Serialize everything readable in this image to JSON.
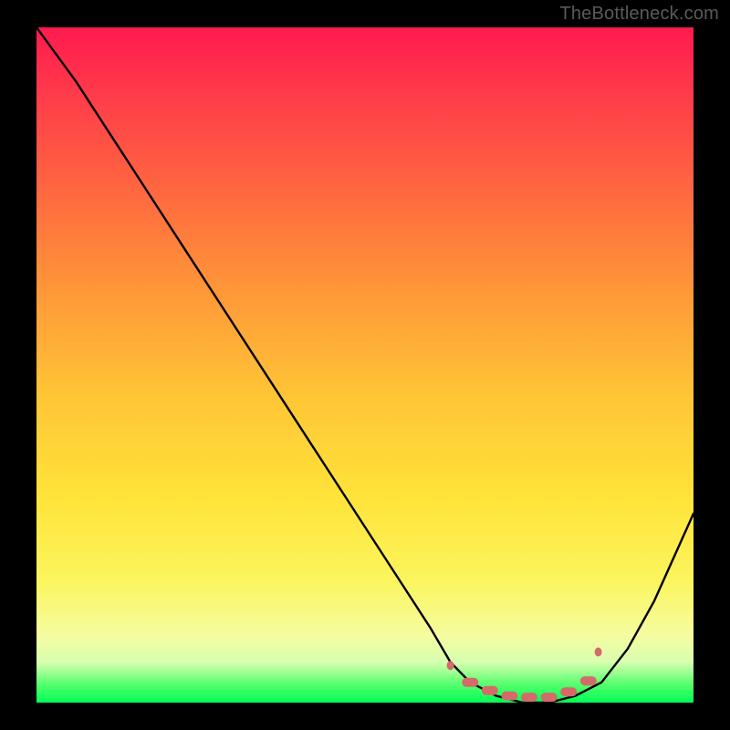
{
  "watermark": "TheBottleneck.com",
  "chart_data": {
    "type": "line",
    "title": "",
    "xlabel": "",
    "ylabel": "",
    "xlim": [
      0,
      100
    ],
    "ylim": [
      0,
      100
    ],
    "series": [
      {
        "name": "bottleneck-curve",
        "x": [
          0,
          6,
          12,
          18,
          24,
          30,
          36,
          42,
          48,
          54,
          60,
          63,
          66,
          70,
          74,
          78,
          82,
          86,
          90,
          94,
          100
        ],
        "y": [
          100,
          92,
          83,
          74,
          65,
          56,
          47,
          38,
          29,
          20,
          11,
          6,
          3,
          1,
          0,
          0,
          1,
          3,
          8,
          15,
          28
        ]
      }
    ],
    "markers": {
      "name": "highlight-band",
      "color": "#d46a6a",
      "x": [
        63,
        66,
        69,
        72,
        75,
        78,
        81,
        84,
        85.5
      ],
      "y": [
        5.5,
        3.0,
        1.8,
        1.0,
        0.8,
        0.8,
        1.6,
        3.2,
        7.5
      ]
    },
    "gradient_stops": [
      {
        "pct": 0,
        "color": "#ff1a4f"
      },
      {
        "pct": 25,
        "color": "#ff6a3f"
      },
      {
        "pct": 55,
        "color": "#ffc636"
      },
      {
        "pct": 82,
        "color": "#fbf55e"
      },
      {
        "pct": 100,
        "color": "#00ff55"
      }
    ]
  }
}
